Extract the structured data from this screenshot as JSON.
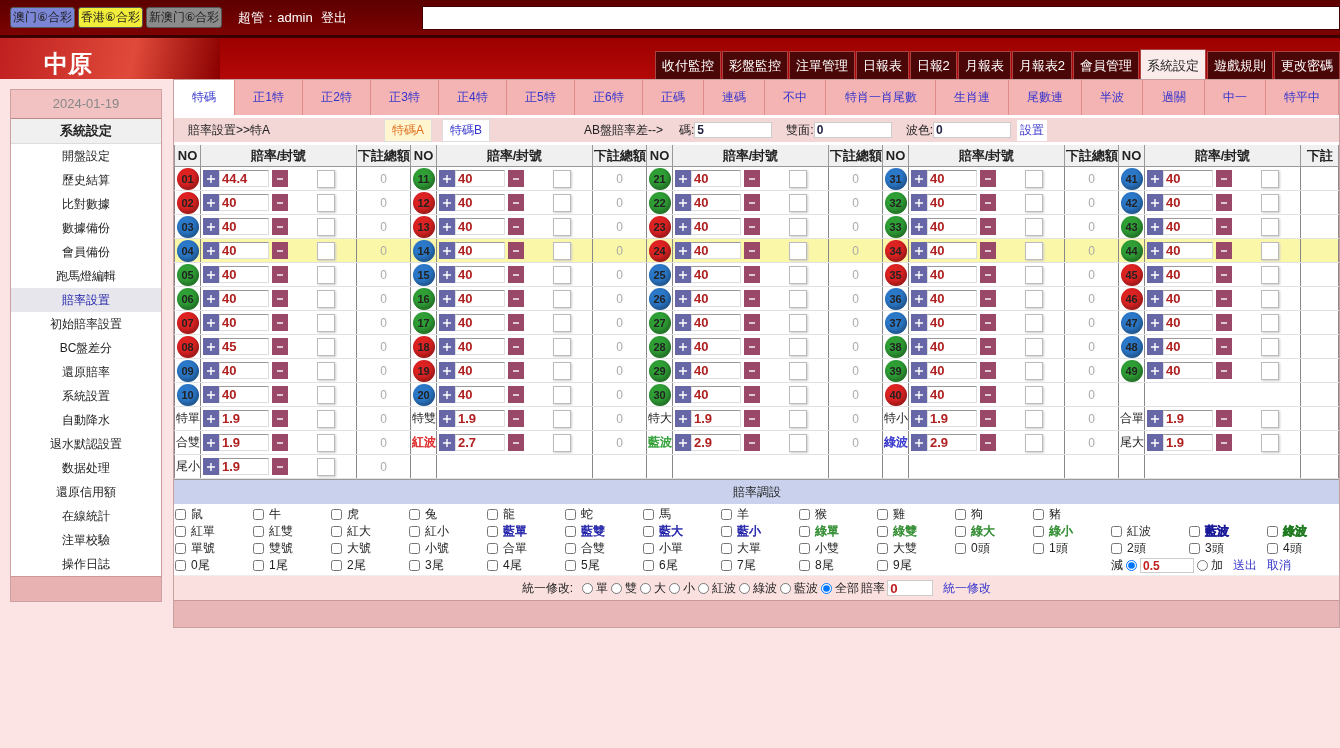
{
  "top_bar": {
    "lotteries": [
      {
        "label": "澳门⑥合彩",
        "color": "#7b86d6"
      },
      {
        "label": "香港⑥合彩",
        "color": "#f2ec3a"
      },
      {
        "label": "新澳门⑥合彩",
        "color": "#8c8c8c"
      }
    ],
    "user": "超管：admin",
    "logout": "登出"
  },
  "header": {
    "logo": "中原",
    "nav": [
      {
        "label": "收付監控",
        "selected": false
      },
      {
        "label": "彩盤監控",
        "selected": false
      },
      {
        "label": "注單管理",
        "selected": false
      },
      {
        "label": "日報表",
        "selected": false
      },
      {
        "label": "日報2",
        "selected": false
      },
      {
        "label": "月報表",
        "selected": false
      },
      {
        "label": "月報表2",
        "selected": false
      },
      {
        "label": "會員管理",
        "selected": false
      },
      {
        "label": "系統設定",
        "selected": true
      },
      {
        "label": "遊戲規則",
        "selected": false
      },
      {
        "label": "更改密碼",
        "selected": false
      }
    ]
  },
  "sidebar": {
    "date": "2024-01-19",
    "heading": "系統設定",
    "items": [
      {
        "label": "開盤設定",
        "selected": false
      },
      {
        "label": "歷史結算",
        "selected": false
      },
      {
        "label": "比對數據",
        "selected": false
      },
      {
        "label": "數據備份",
        "selected": false
      },
      {
        "label": "會員備份",
        "selected": false
      },
      {
        "label": "跑馬燈編輯",
        "selected": false
      },
      {
        "label": "賠率設置",
        "selected": true
      },
      {
        "label": "初始賠率設置",
        "selected": false
      },
      {
        "label": "BC盤差分",
        "selected": false
      },
      {
        "label": "還原賠率",
        "selected": false
      },
      {
        "label": "系統設置",
        "selected": false
      },
      {
        "label": "自動降水",
        "selected": false
      },
      {
        "label": "退水默認設置",
        "selected": false
      },
      {
        "label": "数据处理",
        "selected": false
      },
      {
        "label": "還原信用額",
        "selected": false
      },
      {
        "label": "在線統計",
        "selected": false
      },
      {
        "label": "注單校驗",
        "selected": false
      },
      {
        "label": "操作日誌",
        "selected": false
      }
    ]
  },
  "sub_tabs": [
    {
      "label": "特碼",
      "selected": true
    },
    {
      "label": "正1特",
      "selected": false
    },
    {
      "label": "正2特",
      "selected": false
    },
    {
      "label": "正3特",
      "selected": false
    },
    {
      "label": "正4特",
      "selected": false
    },
    {
      "label": "正5特",
      "selected": false
    },
    {
      "label": "正6特",
      "selected": false
    },
    {
      "label": "正碼",
      "selected": false
    },
    {
      "label": "連碼",
      "selected": false
    },
    {
      "label": "不中",
      "selected": false
    },
    {
      "label": "特肖一肖尾數",
      "selected": false
    },
    {
      "label": "生肖連",
      "selected": false
    },
    {
      "label": "尾數連",
      "selected": false
    },
    {
      "label": "半波",
      "selected": false
    },
    {
      "label": "過關",
      "selected": false
    },
    {
      "label": "中一",
      "selected": false
    },
    {
      "label": "特平中",
      "selected": false
    }
  ],
  "info": {
    "breadcrumb": "賠率設置>>特A",
    "plates": [
      {
        "label": "特碼A",
        "selected": true
      },
      {
        "label": "特碼B",
        "selected": false
      }
    ],
    "ab_label": "AB盤賠率差-->",
    "fields": [
      {
        "label": "碼:",
        "value": "5"
      },
      {
        "label": "雙面:",
        "value": "0"
      },
      {
        "label": "波色:",
        "value": "0"
      }
    ],
    "button": "設置"
  },
  "table": {
    "columns": [
      {
        "no": "NO",
        "odds": "賠率/封號",
        "total": "下註總額"
      },
      {
        "no": "NO",
        "odds": "賠率/封號",
        "total": "下註總額"
      },
      {
        "no": "NO",
        "odds": "賠率/封號",
        "total": "下註總額"
      },
      {
        "no": "NO",
        "odds": "賠率/封號",
        "total": "下註總額"
      },
      {
        "no": "NO",
        "odds": "賠率/封號",
        "total": "下註"
      }
    ],
    "rows": [
      {
        "highlighted": false,
        "cells": [
          {
            "kind": "ball",
            "no": "01",
            "color": "#dd2222",
            "odds": "44.4",
            "total": "0"
          },
          {
            "kind": "ball",
            "no": "11",
            "color": "#2e9e35",
            "odds": "40",
            "total": "0"
          },
          {
            "kind": "ball",
            "no": "21",
            "color": "#2e9e35",
            "odds": "40",
            "total": "0"
          },
          {
            "kind": "ball",
            "no": "31",
            "color": "#2b78c8",
            "odds": "40",
            "total": "0"
          },
          {
            "kind": "ball",
            "no": "41",
            "color": "#2b78c8",
            "odds": "40"
          }
        ]
      },
      {
        "highlighted": false,
        "cells": [
          {
            "kind": "ball",
            "no": "02",
            "color": "#dd2222",
            "odds": "40",
            "total": "0"
          },
          {
            "kind": "ball",
            "no": "12",
            "color": "#dd2222",
            "odds": "40",
            "total": "0"
          },
          {
            "kind": "ball",
            "no": "22",
            "color": "#2e9e35",
            "odds": "40",
            "total": "0"
          },
          {
            "kind": "ball",
            "no": "32",
            "color": "#2e9e35",
            "odds": "40",
            "total": "0"
          },
          {
            "kind": "ball",
            "no": "42",
            "color": "#2b78c8",
            "odds": "40"
          }
        ]
      },
      {
        "highlighted": false,
        "cells": [
          {
            "kind": "ball",
            "no": "03",
            "color": "#2b78c8",
            "odds": "40",
            "total": "0"
          },
          {
            "kind": "ball",
            "no": "13",
            "color": "#dd2222",
            "odds": "40",
            "total": "0"
          },
          {
            "kind": "ball",
            "no": "23",
            "color": "#dd2222",
            "odds": "40",
            "total": "0"
          },
          {
            "kind": "ball",
            "no": "33",
            "color": "#2e9e35",
            "odds": "40",
            "total": "0"
          },
          {
            "kind": "ball",
            "no": "43",
            "color": "#2e9e35",
            "odds": "40"
          }
        ]
      },
      {
        "highlighted": true,
        "cells": [
          {
            "kind": "ball",
            "no": "04",
            "color": "#2b78c8",
            "odds": "40",
            "total": "0"
          },
          {
            "kind": "ball",
            "no": "14",
            "color": "#2b78c8",
            "odds": "40",
            "total": "0"
          },
          {
            "kind": "ball",
            "no": "24",
            "color": "#dd2222",
            "odds": "40",
            "total": "0"
          },
          {
            "kind": "ball",
            "no": "34",
            "color": "#dd2222",
            "odds": "40",
            "total": "0"
          },
          {
            "kind": "ball",
            "no": "44",
            "color": "#2e9e35",
            "odds": "40"
          }
        ]
      },
      {
        "highlighted": false,
        "cells": [
          {
            "kind": "ball",
            "no": "05",
            "color": "#2e9e35",
            "odds": "40",
            "total": "0"
          },
          {
            "kind": "ball",
            "no": "15",
            "color": "#2b78c8",
            "odds": "40",
            "total": "0"
          },
          {
            "kind": "ball",
            "no": "25",
            "color": "#2b78c8",
            "odds": "40",
            "total": "0"
          },
          {
            "kind": "ball",
            "no": "35",
            "color": "#dd2222",
            "odds": "40",
            "total": "0"
          },
          {
            "kind": "ball",
            "no": "45",
            "color": "#dd2222",
            "odds": "40"
          }
        ]
      },
      {
        "highlighted": false,
        "cells": [
          {
            "kind": "ball",
            "no": "06",
            "color": "#2e9e35",
            "odds": "40",
            "total": "0"
          },
          {
            "kind": "ball",
            "no": "16",
            "color": "#2e9e35",
            "odds": "40",
            "total": "0"
          },
          {
            "kind": "ball",
            "no": "26",
            "color": "#2b78c8",
            "odds": "40",
            "total": "0"
          },
          {
            "kind": "ball",
            "no": "36",
            "color": "#2b78c8",
            "odds": "40",
            "total": "0"
          },
          {
            "kind": "ball",
            "no": "46",
            "color": "#dd2222",
            "odds": "40"
          }
        ]
      },
      {
        "highlighted": false,
        "cells": [
          {
            "kind": "ball",
            "no": "07",
            "color": "#dd2222",
            "odds": "40",
            "total": "0"
          },
          {
            "kind": "ball",
            "no": "17",
            "color": "#2e9e35",
            "odds": "40",
            "total": "0"
          },
          {
            "kind": "ball",
            "no": "27",
            "color": "#2e9e35",
            "odds": "40",
            "total": "0"
          },
          {
            "kind": "ball",
            "no": "37",
            "color": "#2b78c8",
            "odds": "40",
            "total": "0"
          },
          {
            "kind": "ball",
            "no": "47",
            "color": "#2b78c8",
            "odds": "40"
          }
        ]
      },
      {
        "highlighted": false,
        "cells": [
          {
            "kind": "ball",
            "no": "08",
            "color": "#dd2222",
            "odds": "45",
            "total": "0"
          },
          {
            "kind": "ball",
            "no": "18",
            "color": "#dd2222",
            "odds": "40",
            "total": "0"
          },
          {
            "kind": "ball",
            "no": "28",
            "color": "#2e9e35",
            "odds": "40",
            "total": "0"
          },
          {
            "kind": "ball",
            "no": "38",
            "color": "#2e9e35",
            "odds": "40",
            "total": "0"
          },
          {
            "kind": "ball",
            "no": "48",
            "color": "#2b78c8",
            "odds": "40"
          }
        ]
      },
      {
        "highlighted": false,
        "cells": [
          {
            "kind": "ball",
            "no": "09",
            "color": "#2b78c8",
            "odds": "40",
            "total": "0"
          },
          {
            "kind": "ball",
            "no": "19",
            "color": "#dd2222",
            "odds": "40",
            "total": "0"
          },
          {
            "kind": "ball",
            "no": "29",
            "color": "#2e9e35",
            "odds": "40",
            "total": "0"
          },
          {
            "kind": "ball",
            "no": "39",
            "color": "#2e9e35",
            "odds": "40",
            "total": "0"
          },
          {
            "kind": "ball",
            "no": "49",
            "color": "#2e9e35",
            "odds": "40"
          }
        ]
      },
      {
        "highlighted": false,
        "cells": [
          {
            "kind": "ball",
            "no": "10",
            "color": "#2b78c8",
            "odds": "40",
            "total": "0"
          },
          {
            "kind": "ball",
            "no": "20",
            "color": "#2b78c8",
            "odds": "40",
            "total": "0"
          },
          {
            "kind": "ball",
            "no": "30",
            "color": "#2e9e35",
            "odds": "40",
            "total": "0"
          },
          {
            "kind": "ball",
            "no": "40",
            "color": "#dd2222",
            "odds": "40",
            "total": "0"
          },
          {
            "kind": "empty"
          }
        ]
      },
      {
        "highlighted": false,
        "cells": [
          {
            "kind": "label",
            "label": "特單",
            "odds": "1.9",
            "total": "0"
          },
          {
            "kind": "label",
            "label": "特雙",
            "odds": "1.9",
            "total": "0"
          },
          {
            "kind": "label",
            "label": "特大",
            "odds": "1.9",
            "total": "0"
          },
          {
            "kind": "label",
            "label": "特小",
            "odds": "1.9",
            "total": "0"
          },
          {
            "kind": "label",
            "label": "合單",
            "odds": "1.9"
          }
        ]
      },
      {
        "highlighted": false,
        "cells": [
          {
            "kind": "label",
            "label": "合雙",
            "odds": "1.9",
            "total": "0"
          },
          {
            "kind": "label",
            "label": "紅波",
            "color": "#dd2222",
            "odds": "2.7",
            "total": "0"
          },
          {
            "kind": "label",
            "label": "藍波",
            "color": "#2e9e35",
            "odds": "2.9",
            "total": "0"
          },
          {
            "kind": "label",
            "label": "綠波",
            "color": "#3333cc",
            "odds": "2.9",
            "total": "0"
          },
          {
            "kind": "label",
            "label": "尾大",
            "odds": "1.9"
          }
        ]
      },
      {
        "highlighted": false,
        "cells": [
          {
            "kind": "label",
            "label": "尾小",
            "odds": "1.9",
            "total": "0"
          },
          {
            "kind": "empty"
          },
          {
            "kind": "empty"
          },
          {
            "kind": "empty"
          },
          {
            "kind": "empty"
          }
        ]
      }
    ]
  },
  "adjust": {
    "title": "賠率調設",
    "rows": [
      [
        {
          "label": "鼠",
          "checked": false
        },
        {
          "label": "牛",
          "checked": false
        },
        {
          "label": "虎",
          "checked": false
        },
        {
          "label": "兔",
          "checked": false
        },
        {
          "label": "龍",
          "checked": false
        },
        {
          "label": "蛇",
          "checked": false
        },
        {
          "label": "馬",
          "checked": false
        },
        {
          "label": "羊",
          "checked": false
        },
        {
          "label": "猴",
          "checked": false
        },
        {
          "label": "雞",
          "checked": false
        },
        {
          "label": "狗",
          "checked": false
        },
        {
          "label": "豬",
          "checked": false
        }
      ],
      [
        {
          "label": "紅單",
          "checked": false
        },
        {
          "label": "紅雙",
          "checked": false
        },
        {
          "label": "紅大",
          "checked": false
        },
        {
          "label": "紅小",
          "checked": false
        },
        {
          "label": "藍單",
          "checked": false,
          "color": "#2222aa"
        },
        {
          "label": "藍雙",
          "checked": false,
          "color": "#2222aa"
        },
        {
          "label": "藍大",
          "checked": false,
          "color": "#2222aa"
        },
        {
          "label": "藍小",
          "checked": false,
          "color": "#2222aa"
        },
        {
          "label": "綠單",
          "checked": false,
          "color": "#2e8b2e"
        },
        {
          "label": "綠雙",
          "checked": false,
          "color": "#2e8b2e"
        },
        {
          "label": "綠大",
          "checked": false,
          "color": "#2e8b2e"
        },
        {
          "label": "綠小",
          "checked": false,
          "color": "#2e8b2e"
        },
        {
          "label": "紅波",
          "checked": false
        },
        {
          "label": "藍波",
          "checked": false,
          "color": "#1a1a99",
          "strong": true
        },
        {
          "label": "綠波",
          "checked": false,
          "color": "#1f7a1f",
          "strong": true
        }
      ],
      [
        {
          "label": "單號",
          "checked": false
        },
        {
          "label": "雙號",
          "checked": false
        },
        {
          "label": "大號",
          "checked": false
        },
        {
          "label": "小號",
          "checked": false
        },
        {
          "label": "合單",
          "checked": false
        },
        {
          "label": "合雙",
          "checked": false
        },
        {
          "label": "小單",
          "checked": false
        },
        {
          "label": "大單",
          "checked": false
        },
        {
          "label": "小雙",
          "checked": false
        },
        {
          "label": "大雙",
          "checked": false
        },
        {
          "label": "0頭",
          "checked": false
        },
        {
          "label": "1頭",
          "checked": false
        },
        {
          "label": "2頭",
          "checked": false
        },
        {
          "label": "3頭",
          "checked": false
        },
        {
          "label": "4頭",
          "checked": false
        }
      ],
      [
        {
          "label": "0尾",
          "checked": false
        },
        {
          "label": "1尾",
          "checked": false
        },
        {
          "label": "2尾",
          "checked": false
        },
        {
          "label": "3尾",
          "checked": false
        },
        {
          "label": "4尾",
          "checked": false
        },
        {
          "label": "5尾",
          "checked": false
        },
        {
          "label": "6尾",
          "checked": false
        },
        {
          "label": "7尾",
          "checked": false
        },
        {
          "label": "8尾",
          "checked": false
        },
        {
          "label": "9尾",
          "checked": false
        }
      ]
    ],
    "modes": [
      {
        "label": "減",
        "selected": true
      },
      {
        "label": "加",
        "selected": false
      }
    ],
    "value": "0.5",
    "links": [
      "送出",
      "取消"
    ]
  },
  "unify": {
    "label": "統一修改:",
    "options": [
      {
        "label": "單",
        "selected": false
      },
      {
        "label": "雙",
        "selected": false
      },
      {
        "label": "大",
        "selected": false
      },
      {
        "label": "小",
        "selected": false
      },
      {
        "label": "紅波",
        "selected": false
      },
      {
        "label": "綠波",
        "selected": false
      },
      {
        "label": "藍波",
        "selected": false
      },
      {
        "label": "全部",
        "selected": true
      }
    ],
    "odds_label": "賠率",
    "odds_value": "0",
    "button": "統一修改"
  }
}
